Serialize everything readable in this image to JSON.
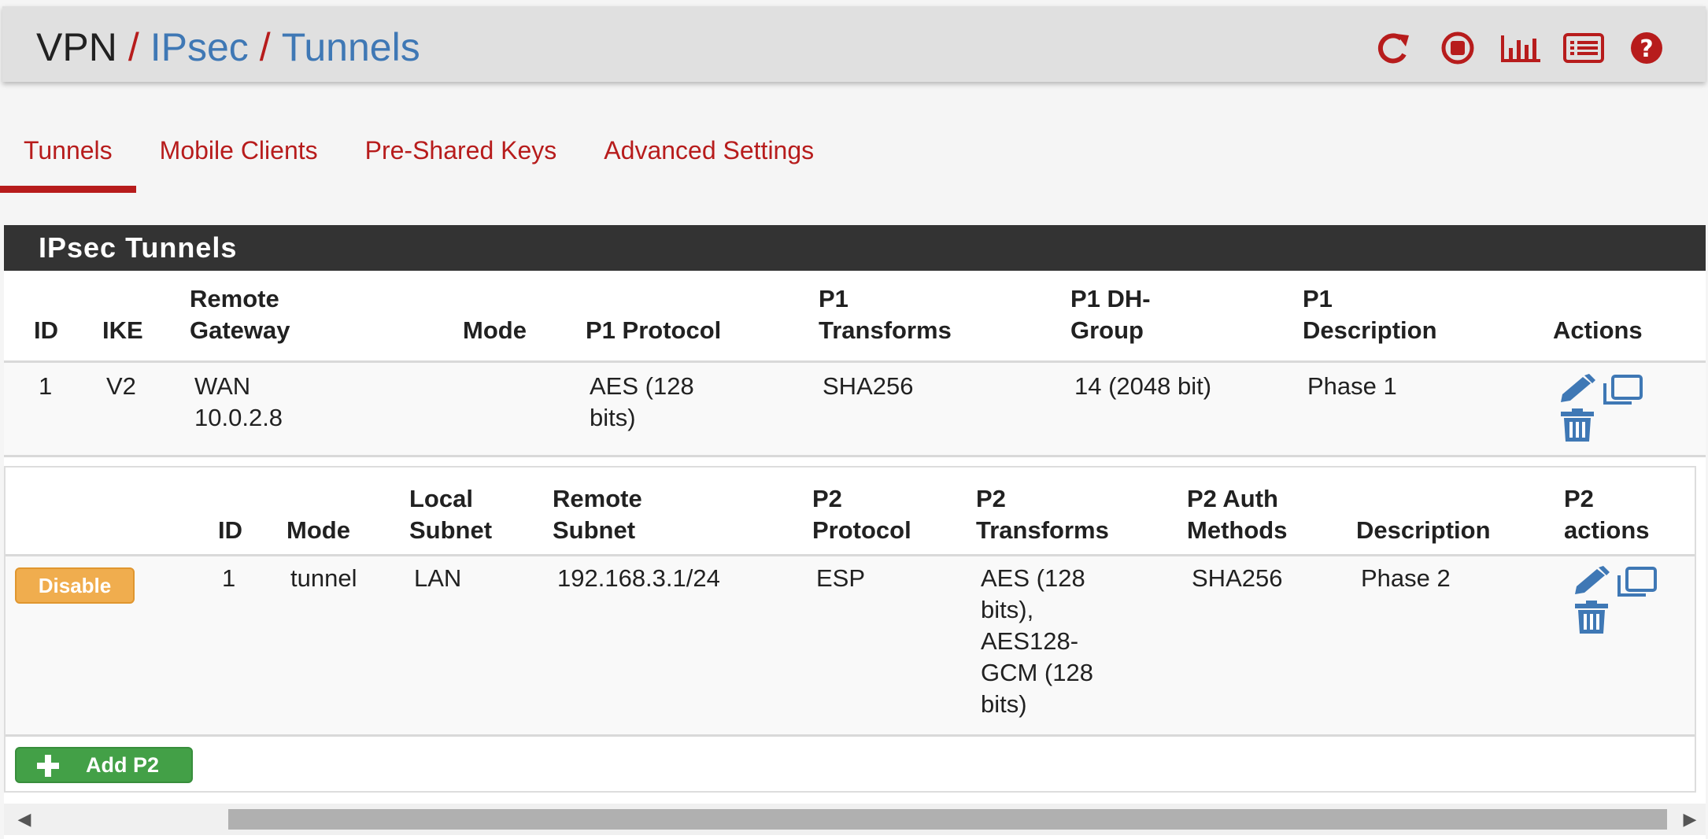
{
  "breadcrumb": {
    "root": "VPN",
    "sep": "/",
    "level1": "IPsec",
    "level2": "Tunnels"
  },
  "header_icons": [
    "refresh-icon",
    "stop-circle-icon",
    "bar-chart-icon",
    "list-icon",
    "help-icon"
  ],
  "colors": {
    "accent": "#b71c1c",
    "link": "#3f78b5",
    "panel_head": "#333333",
    "disable": "#f0ad4e",
    "add": "#43a047",
    "action_icon": "#3f78b5"
  },
  "tabs": [
    {
      "label": "Tunnels",
      "active": true
    },
    {
      "label": "Mobile Clients",
      "active": false
    },
    {
      "label": "Pre-Shared Keys",
      "active": false
    },
    {
      "label": "Advanced Settings",
      "active": false
    }
  ],
  "panel": {
    "title": "IPsec Tunnels"
  },
  "p1_headers": {
    "id": "ID",
    "ike": "IKE",
    "remote_gw_1": "Remote",
    "remote_gw_2": "Gateway",
    "mode": "Mode",
    "protocol": "P1 Protocol",
    "transforms_1": "P1",
    "transforms_2": "Transforms",
    "dh_1": "P1 DH-",
    "dh_2": "Group",
    "desc_1": "P1",
    "desc_2": "Description",
    "actions": "Actions"
  },
  "p1_row": {
    "id": "1",
    "ike": "V2",
    "gateway_iface": "WAN",
    "gateway_ip": "10.0.2.8",
    "mode": "",
    "protocol_1": "AES (128",
    "protocol_2": "bits)",
    "transforms": "SHA256",
    "dh_group": "14 (2048 bit)",
    "description": "Phase 1",
    "actions": [
      "edit-icon",
      "clone-icon",
      "delete-icon"
    ]
  },
  "p2_headers": {
    "id": "ID",
    "mode": "Mode",
    "local_1": "Local",
    "local_2": "Subnet",
    "remote_1": "Remote",
    "remote_2": "Subnet",
    "protocol_1": "P2",
    "protocol_2": "Protocol",
    "transforms_1": "P2",
    "transforms_2": "Transforms",
    "auth_1": "P2 Auth",
    "auth_2": "Methods",
    "description": "Description",
    "actions_1": "P2",
    "actions_2": "actions"
  },
  "p2_row": {
    "disable_label": "Disable",
    "id": "1",
    "mode": "tunnel",
    "local_subnet": "LAN",
    "remote_subnet": "192.168.3.1/24",
    "protocol": "ESP",
    "transforms_lines": [
      "AES (128",
      "bits),",
      "AES128-",
      "GCM (128",
      "bits)"
    ],
    "auth_methods": "SHA256",
    "description": "Phase 2",
    "actions": [
      "edit-icon",
      "clone-icon",
      "delete-icon"
    ]
  },
  "add_p2_label": "Add P2",
  "scrollbar": {
    "left_arrow": "◀",
    "right_arrow": "▶"
  }
}
